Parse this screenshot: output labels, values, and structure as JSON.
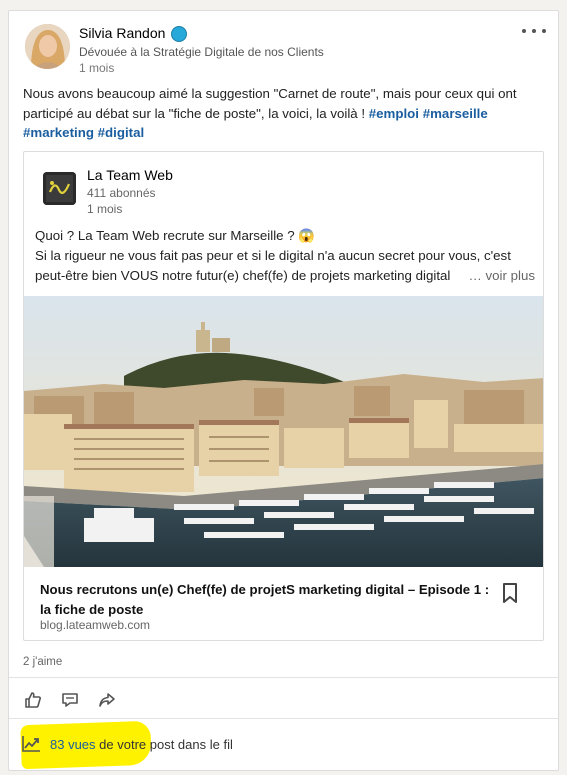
{
  "post": {
    "author": {
      "name": "Silvia Randon",
      "headline": "Dévouée à la Stratégie Digitale de nos Clients",
      "time": "1 mois"
    },
    "text_line1": "Nous avons beaucoup aimé la suggestion \"Carnet de route\", mais pour ceux qui ont",
    "text_line2_plain": "participé au débat sur la \"fiche de poste\", la voici, la voilà ! ",
    "hashtags": [
      "#emploi",
      "#marseille",
      "#marketing",
      "#digital"
    ]
  },
  "shared": {
    "company": "La Team Web",
    "followers": "411 abonnés",
    "time": "1 mois",
    "line1": "Quoi ? La Team Web recrute sur Marseille ? 😱",
    "line2": "Si la rigueur ne vous fait pas peur et si le digital n'a aucun secret pour vous, c'est",
    "line3": "peut-être bien VOUS notre futur(e) chef(fe) de projets marketing digital",
    "see_more": "… voir plus",
    "link_title": "Nous recrutons un(e) Chef(fe) de projetS marketing digital – Episode 1 : la fiche de poste",
    "link_domain": "blog.lateamweb.com"
  },
  "social": {
    "likes": "2 j'aime",
    "views_count": "83 vues",
    "views_rest": " de votre post dans le fil"
  },
  "icons": {
    "verified": "verified-badge-icon",
    "more": "ellipsis-icon",
    "bookmark": "bookmark-icon",
    "like": "thumbs-up-icon",
    "comment": "comment-icon",
    "share": "share-icon",
    "views": "trending-chart-icon"
  },
  "colors": {
    "link": "#1a5ea0",
    "highlight": "#fff200",
    "verified": "#26a8d8"
  }
}
